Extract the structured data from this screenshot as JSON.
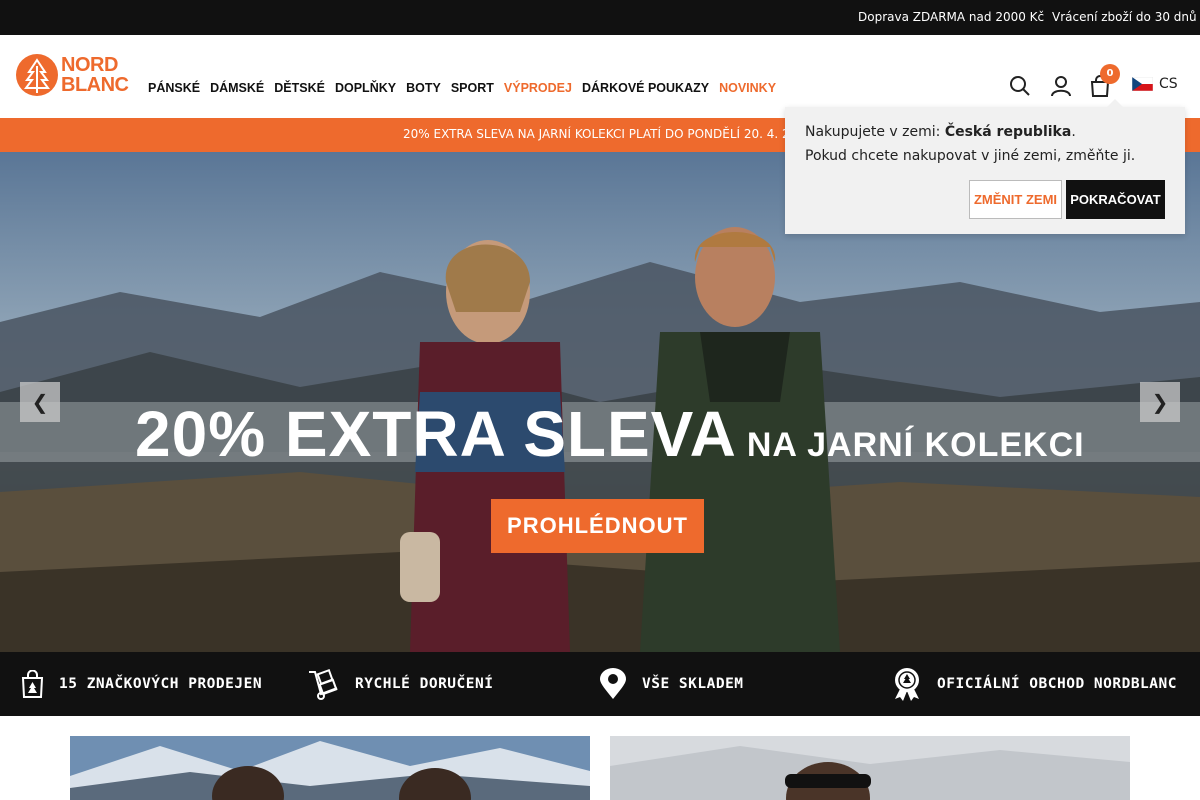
{
  "topbar": {
    "free_shipping": "Doprava ZDARMA nad 2000 Kč",
    "returns": "Vrácení zboží do 30 dnů"
  },
  "header": {
    "logo_line1": "NORD",
    "logo_line2": "BLANC",
    "nav": [
      "PÁNSKÉ",
      "DÁMSKÉ",
      "DĚTSKÉ",
      "DOPLŇKY",
      "BOTY",
      "SPORT",
      "VÝPRODEJ",
      "DÁRKOVÉ POUKAZY",
      "NOVINKY"
    ],
    "cart_count": "0",
    "language": "CS",
    "accent_color": "#ee6a2d"
  },
  "promo": {
    "text": "20% EXTRA SLEVA NA JARNÍ KOLEKCI PLATÍ DO PONDĚLÍ 20. 4. 20"
  },
  "hero": {
    "title_big": "20% EXTRA SLEVA",
    "title_small": "NA JARNÍ KOLEKCI",
    "button": "PROHLÉDNOUT",
    "prev": "❮",
    "next": "❯"
  },
  "popup": {
    "line1_prefix": "Nakupujete v zemi: ",
    "country": "Česká republika",
    "line1_suffix": ".",
    "line2": "Pokud chcete nakupovat v jiné zemi, změňte ji.",
    "change_button": "ZMĚNIT ZEMI",
    "continue_button": "POKRAČOVAT"
  },
  "benefits": [
    {
      "icon": "shopping-bag-icon",
      "label": "15 ZNAČKOVÝCH PRODEJEN"
    },
    {
      "icon": "hand-truck-icon",
      "label": "RYCHLÉ DORUČENÍ"
    },
    {
      "icon": "location-pin-icon",
      "label": "VŠE SKLADEM"
    },
    {
      "icon": "award-badge-icon",
      "label": "OFICIÁLNÍ OBCHOD NORDBLANC"
    }
  ]
}
